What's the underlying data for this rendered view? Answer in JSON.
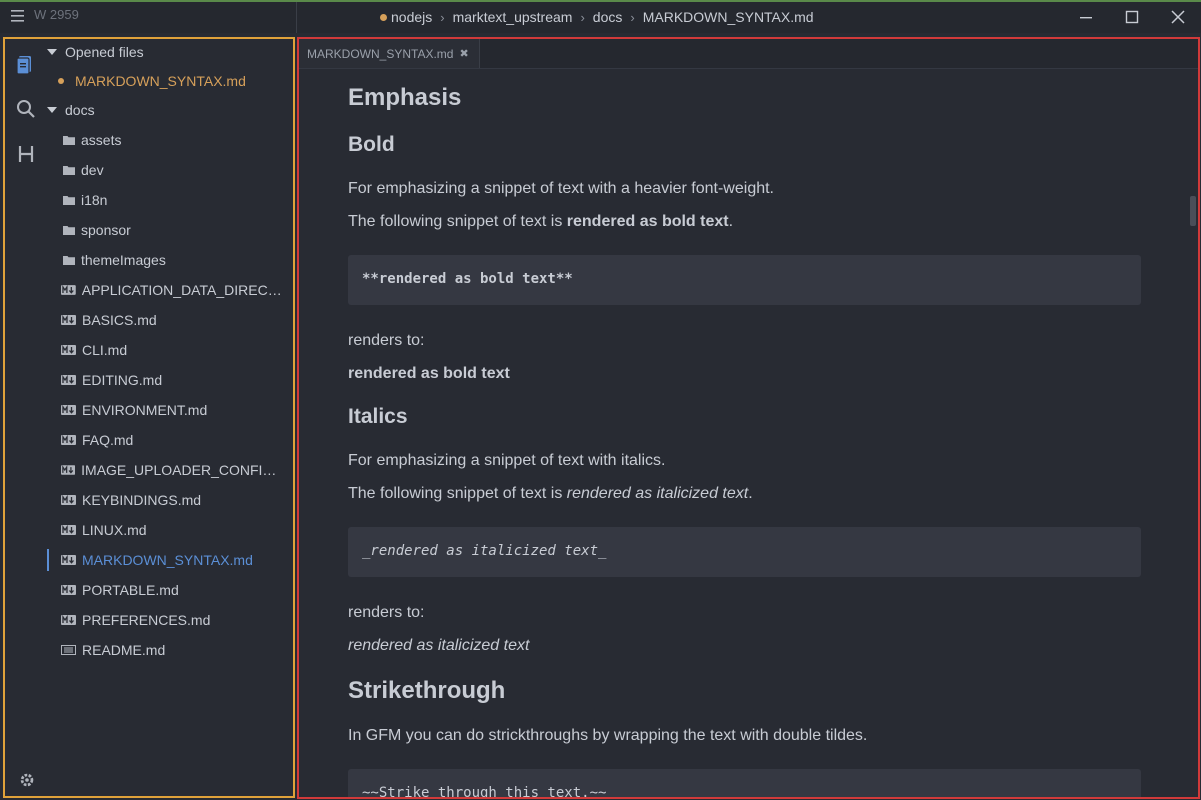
{
  "titlebar": {
    "word_count": "W 2959",
    "breadcrumb": [
      "nodejs",
      "marktext_upstream",
      "docs",
      "MARKDOWN_SYNTAX.md"
    ]
  },
  "sidebar": {
    "opened_files_label": "Opened files",
    "opened_files": [
      "MARKDOWN_SYNTAX.md"
    ],
    "root_folder": "docs",
    "folders": [
      "assets",
      "dev",
      "i18n",
      "sponsor",
      "themeImages"
    ],
    "files": [
      "APPLICATION_DATA_DIRECT...",
      "BASICS.md",
      "CLI.md",
      "EDITING.md",
      "ENVIRONMENT.md",
      "FAQ.md",
      "IMAGE_UPLOADER_CONFIGR...",
      "KEYBINDINGS.md",
      "LINUX.md",
      "MARKDOWN_SYNTAX.md",
      "PORTABLE.md",
      "PREFERENCES.md",
      "README.md"
    ],
    "active_file": "MARKDOWN_SYNTAX.md"
  },
  "tabs": [
    {
      "label": "MARKDOWN_SYNTAX.md",
      "close": "✖"
    }
  ],
  "document": {
    "emphasis_heading": "Emphasis",
    "bold": {
      "heading": "Bold",
      "intro": "For emphasizing a snippet of text with a heavier font-weight.",
      "sentence_prefix": "The following snippet of text is ",
      "sentence_emph": "rendered as bold text",
      "sentence_suffix": ".",
      "code": "**rendered as bold text**",
      "renders_to": "renders to:",
      "result": "rendered as bold text"
    },
    "italics": {
      "heading": "Italics",
      "intro": "For emphasizing a snippet of text with italics.",
      "sentence_prefix": "The following snippet of text is ",
      "sentence_emph": "rendered as italicized text",
      "sentence_suffix": ".",
      "code": "_rendered as italicized text_",
      "renders_to": "renders to:",
      "result": "rendered as italicized text"
    },
    "strike": {
      "heading": "Strikethrough",
      "intro": "In GFM you can do strickthroughs by wrapping the text with double tildes.",
      "code": "~~Strike through this text.~~"
    }
  },
  "colors": {
    "accent_active": "#5b8fd6",
    "unsaved_dot": "#d6a05a",
    "sidebar_border": "#e0a23a",
    "editor_border": "#d13a3a"
  }
}
